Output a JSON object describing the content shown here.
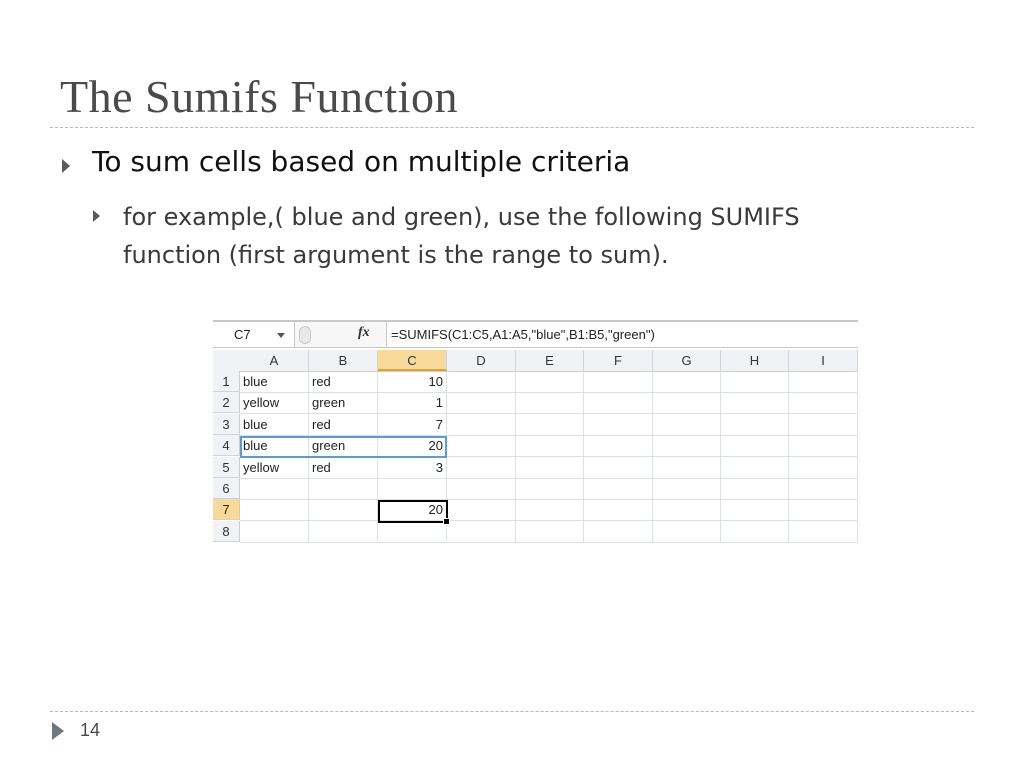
{
  "slide": {
    "title": "The Sumifs Function",
    "bullet1": "To sum cells based on multiple criteria",
    "bullet2_line1": "for example,( blue and green), use the following SUMIFS",
    "bullet2_line2": "function (first argument is the range to sum).",
    "page_number": "14"
  },
  "spreadsheet": {
    "name_box": "C7",
    "fx_symbol": "fx",
    "formula": "=SUMIFS(C1:C5,A1:A5,\"blue\",B1:B5,\"green\")",
    "columns": [
      "A",
      "B",
      "C",
      "D",
      "E",
      "F",
      "G",
      "H",
      "I"
    ],
    "selected_column": "C",
    "rows": [
      "1",
      "2",
      "3",
      "4",
      "5",
      "6",
      "7",
      "8"
    ],
    "selected_row": "7",
    "cells": [
      [
        "blue",
        "red",
        "10"
      ],
      [
        "yellow",
        "green",
        "1"
      ],
      [
        "blue",
        "red",
        "7"
      ],
      [
        "blue",
        "green",
        "20"
      ],
      [
        "yellow",
        "red",
        "3"
      ],
      [
        "",
        "",
        ""
      ],
      [
        "",
        "",
        "20"
      ],
      [
        "",
        "",
        ""
      ]
    ],
    "colors": {
      "header_selected": "#f9d99a",
      "row_highlight_border": "#5b9bd5"
    }
  }
}
